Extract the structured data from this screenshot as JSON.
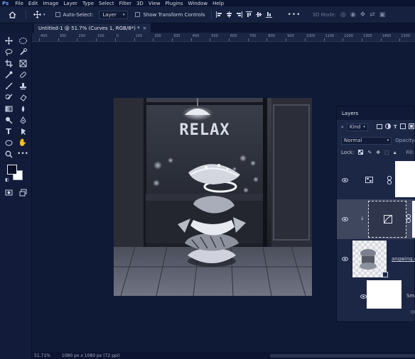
{
  "menubar": {
    "logo": "Ps",
    "items": [
      "File",
      "Edit",
      "Image",
      "Layer",
      "Type",
      "Select",
      "Filter",
      "3D",
      "View",
      "Plugins",
      "Window",
      "Help"
    ]
  },
  "options": {
    "auto_select_label": "Auto-Select:",
    "auto_select_value": "Layer",
    "show_transform_label": "Show Transform Controls",
    "mode_3d_label": "3D Mode:"
  },
  "tab": {
    "title": "Untitled-1 @ 51.7% (Curves 1, RGB/8*) *"
  },
  "ruler": {
    "labels": [
      "400",
      "300",
      "200",
      "100",
      "0",
      "100",
      "200",
      "300",
      "400",
      "500",
      "600",
      "700",
      "800",
      "900",
      "1000",
      "1100",
      "1200",
      "1300",
      "1400",
      "1500"
    ]
  },
  "status": {
    "zoom": "51.71%",
    "doc_info": "1080 px x 1080 px (72 ppi)"
  },
  "document": {
    "sign_text": "RELAX"
  },
  "layers_panel": {
    "title": "Layers",
    "filter_kind": "Kind",
    "blend_mode": "Normal",
    "opacity_label": "Opacity:",
    "lock_label": "Lock:",
    "fill_label": "Fill:",
    "layer_name_smart": "angwing.co",
    "layer_name_bottom": "Sma",
    "layer_name_partial": "Ol"
  },
  "colors": {
    "accent": "#6ea1ff",
    "background": "#0f1a36",
    "panel": "#1c2645"
  }
}
